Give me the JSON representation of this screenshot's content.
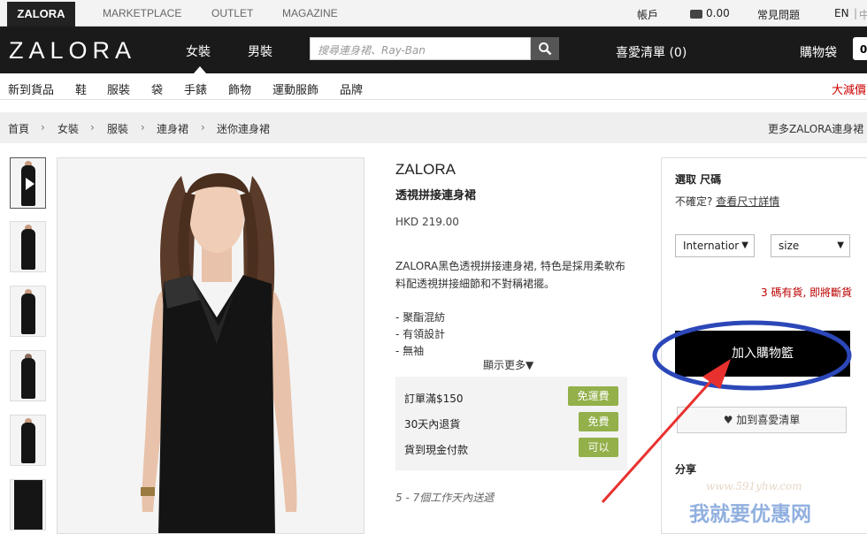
{
  "topbar": {
    "brand_tab": "ZALORA",
    "sites": [
      "MARKETPLACE",
      "OUTLET",
      "MAGAZINE"
    ],
    "account": "帳戶",
    "wallet": "0.00",
    "faq": "常見問題",
    "lang": "EN",
    "lang_sep": "|",
    "lang_alt": "中"
  },
  "header": {
    "logo": "ZALORA",
    "nav": [
      "女裝",
      "男裝"
    ],
    "search_placeholder": "搜尋連身裙、Ray-Ban",
    "wishlist": "喜愛清單 (0)",
    "cart": "購物袋",
    "cart_count": "0"
  },
  "categories": [
    "新到貨品",
    "鞋",
    "服裝",
    "袋",
    "手錶",
    "飾物",
    "運動服飾",
    "品牌"
  ],
  "sale": "大減價",
  "breadcrumb": [
    "首頁",
    "女裝",
    "服裝",
    "連身裙",
    "迷你連身裙"
  ],
  "breadcrumb_more": "更多ZALORA連身裙",
  "product": {
    "brand": "ZALORA",
    "name": "透視拼接連身裙",
    "price": "HKD 219.00",
    "desc_line1": "ZALORA黑色透視拼接連身裙, 特色是採用柔軟布",
    "desc_line2": "料配透視拼接細節和不對稱裙擺。",
    "bullets": [
      "- 聚酯混紡",
      "- 有領設計",
      "- 無袖"
    ],
    "show_more": "顯示更多▼",
    "perks": [
      {
        "label": "訂單滿$150",
        "badge": "免運費"
      },
      {
        "label": "30天內退貨",
        "badge": "免費"
      },
      {
        "label": "貨到現金付款",
        "badge": "可以"
      }
    ],
    "delivery": "5 - 7個工作天內送遞"
  },
  "panel": {
    "size_title": "選取 尺碼",
    "unsure": "不確定?",
    "size_link": "查看尺寸詳情",
    "select_system": "Internatior",
    "select_size": "size",
    "stock": "3 碼有貨, 即將斷貨",
    "add_to_cart": "加入購物籃",
    "add_wishlist": "加到喜愛清單",
    "share": "分享"
  },
  "watermark": {
    "url": "www.591yhw.com",
    "text": "我就要优惠网"
  },
  "colors": {
    "header_bg": "#1a1a1a",
    "perk_badge": "#93b04a",
    "annotation_ellipse": "#2b47b8",
    "annotation_arrow": "#e8312f"
  }
}
